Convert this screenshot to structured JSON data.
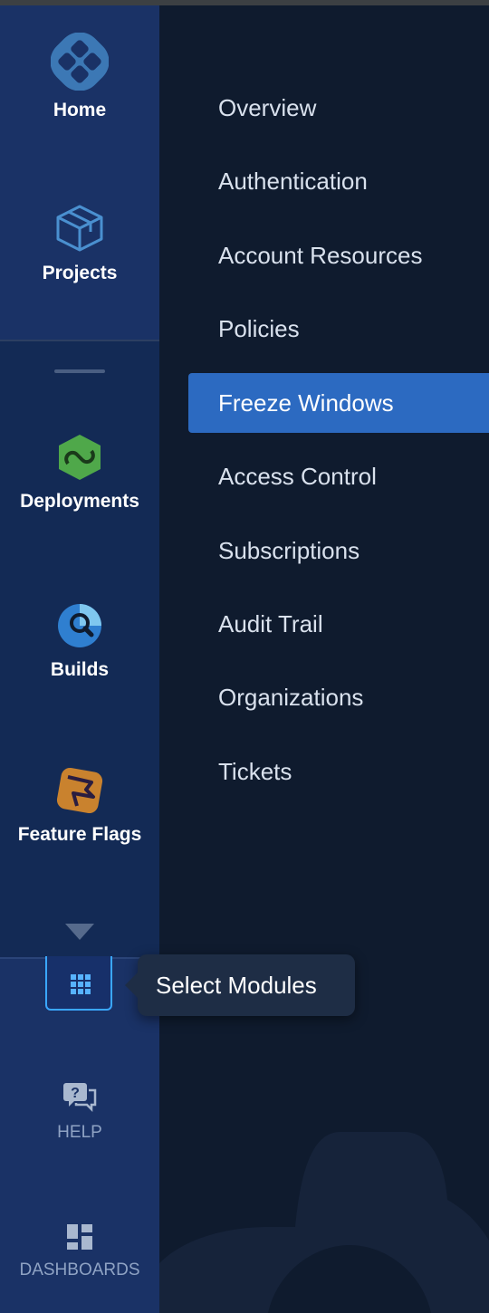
{
  "nav": {
    "home_label": "Home",
    "projects_label": "Projects",
    "modules": [
      {
        "label": "Deployments",
        "icon": "deployments-icon",
        "color": "#4fa84a"
      },
      {
        "label": "Builds",
        "icon": "builds-icon",
        "color": "#3b8fd9"
      },
      {
        "label": "Feature Flags",
        "icon": "feature-flags-icon",
        "color": "#c9822e"
      }
    ],
    "help_label": "HELP",
    "dashboards_label": "DASHBOARDS"
  },
  "tooltip": {
    "text": "Select Modules"
  },
  "menu": {
    "items": [
      {
        "label": "Overview"
      },
      {
        "label": "Authentication"
      },
      {
        "label": "Account Resources"
      },
      {
        "label": "Policies"
      },
      {
        "label": "Freeze Windows",
        "active": true
      },
      {
        "label": "Access Control"
      },
      {
        "label": "Subscriptions"
      },
      {
        "label": "Audit Trail"
      },
      {
        "label": "Organizations"
      },
      {
        "label": "Tickets"
      }
    ]
  },
  "colors": {
    "accent": "#2c6ac1",
    "nav_bg": "#1a3266",
    "menu_bg": "#0f1b2e",
    "focus_outline": "#3aa7ff"
  }
}
